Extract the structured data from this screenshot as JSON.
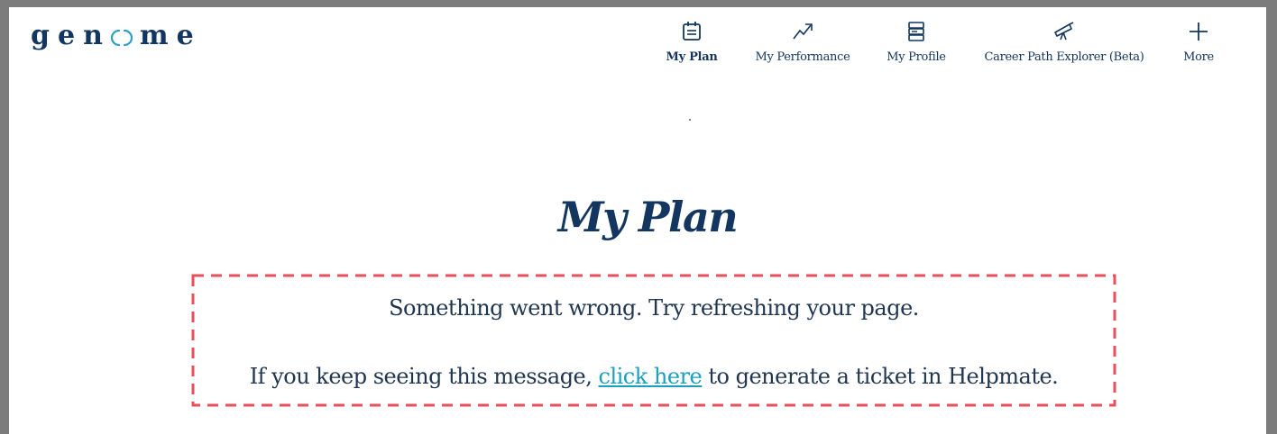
{
  "app": {
    "logo_text": "gen me",
    "colors": {
      "brand_navy": "#12365f",
      "link": "#1a9fbf",
      "dash_red": "#e8505b",
      "logo_ring": "#2b9fc4"
    }
  },
  "nav": {
    "items": [
      {
        "label": "My Plan",
        "icon": "calendar-icon",
        "active": true
      },
      {
        "label": "My Performance",
        "icon": "trend-up-icon",
        "active": false
      },
      {
        "label": "My Profile",
        "icon": "profile-stack-icon",
        "active": false
      },
      {
        "label": "Career Path Explorer (Beta)",
        "icon": "telescope-icon",
        "active": false
      },
      {
        "label": "More",
        "icon": "plus-icon",
        "active": false
      }
    ]
  },
  "page": {
    "title": "My Plan",
    "dot": "."
  },
  "error": {
    "line1": "Something went wrong. Try refreshing your page.",
    "line2_prefix": "If you keep seeing this message, ",
    "line2_link": "click here",
    "line2_suffix": " to generate a ticket in Helpmate."
  }
}
